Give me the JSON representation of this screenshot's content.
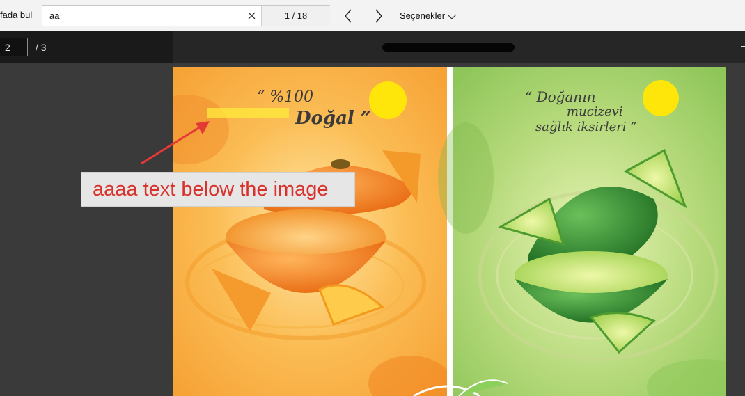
{
  "findbar": {
    "label": "fada bul",
    "search_value": "aa",
    "match_count": "1 / 18",
    "options_label": "Seçenekler"
  },
  "pagebar": {
    "current_page": "2",
    "page_total": "/ 3"
  },
  "annotation": {
    "callout_text": "aaaa text below the image",
    "arrow_color": "#e53935",
    "highlight_color": "#ffeb3b"
  },
  "document": {
    "left_panel_text_line1": "“ %100",
    "left_panel_text_line2": "Doğal ”",
    "right_panel_text_line1": "“ Doğanın",
    "right_panel_text_line2": "mucizevi",
    "right_panel_text_line3": "sağlık iksirleri ”"
  },
  "colors": {
    "findbar_bg": "#f3f3f3",
    "pagebar_bg": "#1a1a1a",
    "orange_panel": "#f7a93a",
    "green_panel": "#a8d16c",
    "sun_yellow": "#ffe60a"
  },
  "icons": {
    "clear": "close-icon",
    "prev": "chevron-left-icon",
    "next": "chevron-right-icon",
    "options": "chevron-down-icon"
  }
}
